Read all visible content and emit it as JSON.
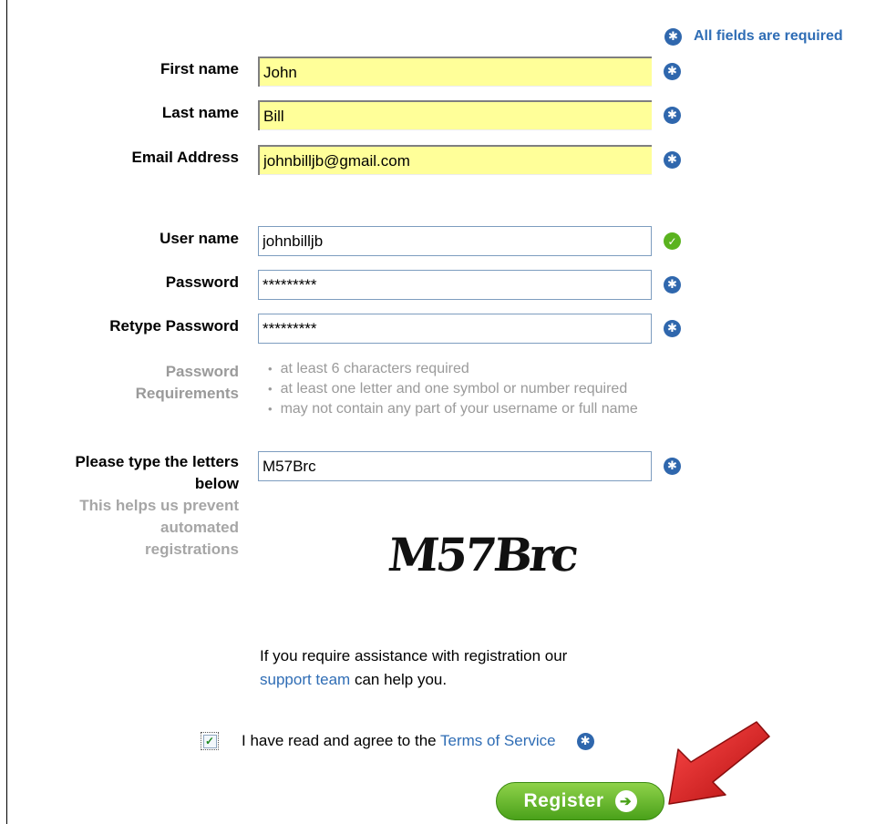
{
  "required_note": "All fields are required",
  "fields": {
    "first_name": {
      "label": "First name",
      "value": "John"
    },
    "last_name": {
      "label": "Last name",
      "value": "Bill"
    },
    "email": {
      "label": "Email Address",
      "value": "johnbilljb@gmail.com"
    },
    "username": {
      "label": "User name",
      "value": "johnbilljb"
    },
    "password": {
      "label": "Password",
      "value": "*********"
    },
    "retype_password": {
      "label": "Retype Password",
      "value": "*********"
    },
    "captcha": {
      "label_line1": "Please type the letters",
      "label_line2": "below",
      "value": "M57Brc"
    }
  },
  "password_requirements": {
    "label_line1": "Password",
    "label_line2": "Requirements",
    "items": [
      "at least 6 characters required",
      "at least one letter and one symbol or number required",
      "may not contain any part of your username or full name"
    ]
  },
  "captcha_help": {
    "line1": "This helps us prevent",
    "line2": "automated",
    "line3": "registrations"
  },
  "captcha_image_text": "M57Brc",
  "assistance": {
    "line1": "If you require assistance with registration our",
    "link": "support team",
    "after_link": "can help you."
  },
  "tos": {
    "checked": true,
    "text": "I have read and agree to the",
    "link": "Terms of Service"
  },
  "register_button": "Register",
  "icons": {
    "required": "star-icon",
    "valid": "check-icon",
    "button_arrow": "arrow-right-circle-icon",
    "annotation_arrow": "red-arrow"
  },
  "colors": {
    "link": "#2f6db5",
    "required_icon": "#2f67ad",
    "valid_icon": "#5ab31f",
    "highlight_input": "#ffff99",
    "register_button": "#4aa11a",
    "annotation_arrow": "#d11a1a"
  }
}
